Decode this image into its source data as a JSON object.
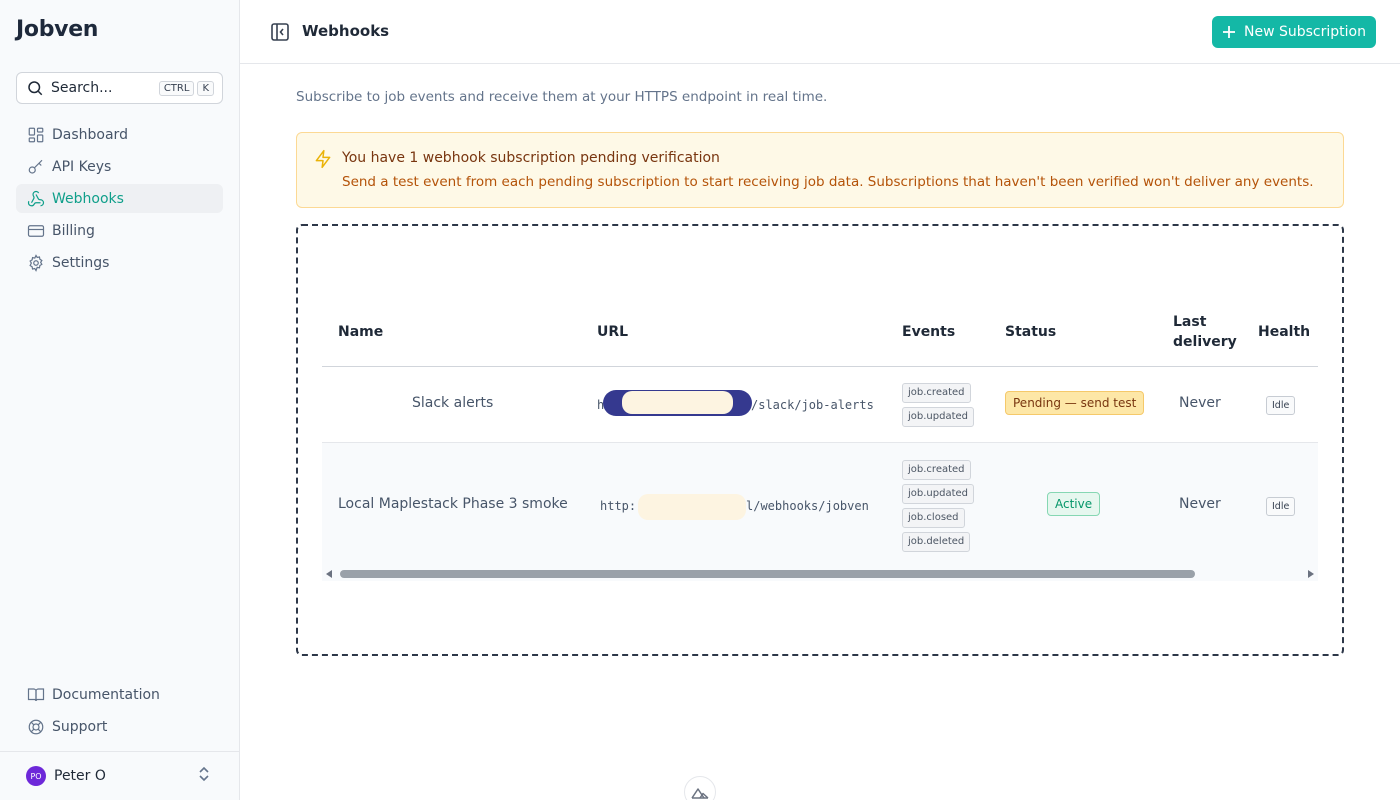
{
  "app": {
    "name": "Jobven"
  },
  "search": {
    "label": "Search...",
    "shortcut_keys": [
      "CTRL",
      "K"
    ]
  },
  "sidebar": {
    "items": [
      {
        "label": "Dashboard",
        "icon": "dashboard-icon",
        "active": false
      },
      {
        "label": "API Keys",
        "icon": "key-icon",
        "active": false
      },
      {
        "label": "Webhooks",
        "icon": "webhook-icon",
        "active": true
      },
      {
        "label": "Billing",
        "icon": "credit-card-icon",
        "active": false
      },
      {
        "label": "Settings",
        "icon": "gear-icon",
        "active": false
      }
    ],
    "bottom_items": [
      {
        "label": "Documentation",
        "icon": "book-icon"
      },
      {
        "label": "Support",
        "icon": "lifebuoy-icon"
      }
    ],
    "user": {
      "initials": "PO",
      "name": "Peter O"
    }
  },
  "header": {
    "title": "Webhooks",
    "new_button": "New Subscription"
  },
  "main": {
    "subtitle": "Subscribe to job events and receive them at your HTTPS endpoint in real time.",
    "alert": {
      "title": "You have 1 webhook subscription pending verification",
      "description": "Send a test event from each pending subscription to start receiving job data. Subscriptions that haven't been verified won't deliver any events."
    },
    "table": {
      "columns": [
        "Name",
        "URL",
        "Events",
        "Status",
        "Last delivery",
        "Health"
      ],
      "rows": [
        {
          "name": "Slack alerts",
          "url_prefix": "h",
          "url_suffix": "/slack/job-alerts",
          "events": [
            "job.created",
            "job.updated"
          ],
          "status": "Pending — send test",
          "last_delivery": "Never",
          "health": "Idle"
        },
        {
          "name": "Local Maplestack Phase 3 smoke",
          "url_prefix": "http:",
          "url_suffix": "l/webhooks/jobven",
          "events": [
            "job.created",
            "job.updated",
            "job.closed",
            "job.deleted"
          ],
          "status": "Active",
          "last_delivery": "Never",
          "health": "Idle"
        }
      ]
    }
  },
  "colors": {
    "accent": "#14b8a6",
    "active_nav": "#0f9f8a",
    "warning_bg": "#fef9e7",
    "warning_text": "#b45309",
    "pending_badge": "#fde7a7",
    "active_badge": "#e6f7ef",
    "avatar": "#6d28d9"
  }
}
